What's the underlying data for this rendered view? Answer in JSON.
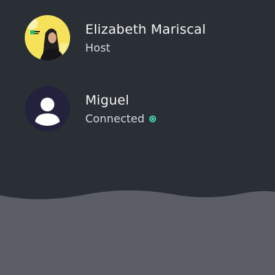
{
  "participants": [
    {
      "name": "Elizabeth Mariscal",
      "role": "Host",
      "avatar_type": "photo",
      "avatar_bg": "#f5e25a"
    },
    {
      "name": "Miguel",
      "status": "Connected",
      "status_icon": "connected-dot-icon",
      "status_color": "#3fd6b0",
      "avatar_type": "default-person-icon",
      "avatar_bg": "#23223d"
    }
  ],
  "colors": {
    "background": "#2a2f36",
    "bottom_panel": "#5b5e66"
  }
}
